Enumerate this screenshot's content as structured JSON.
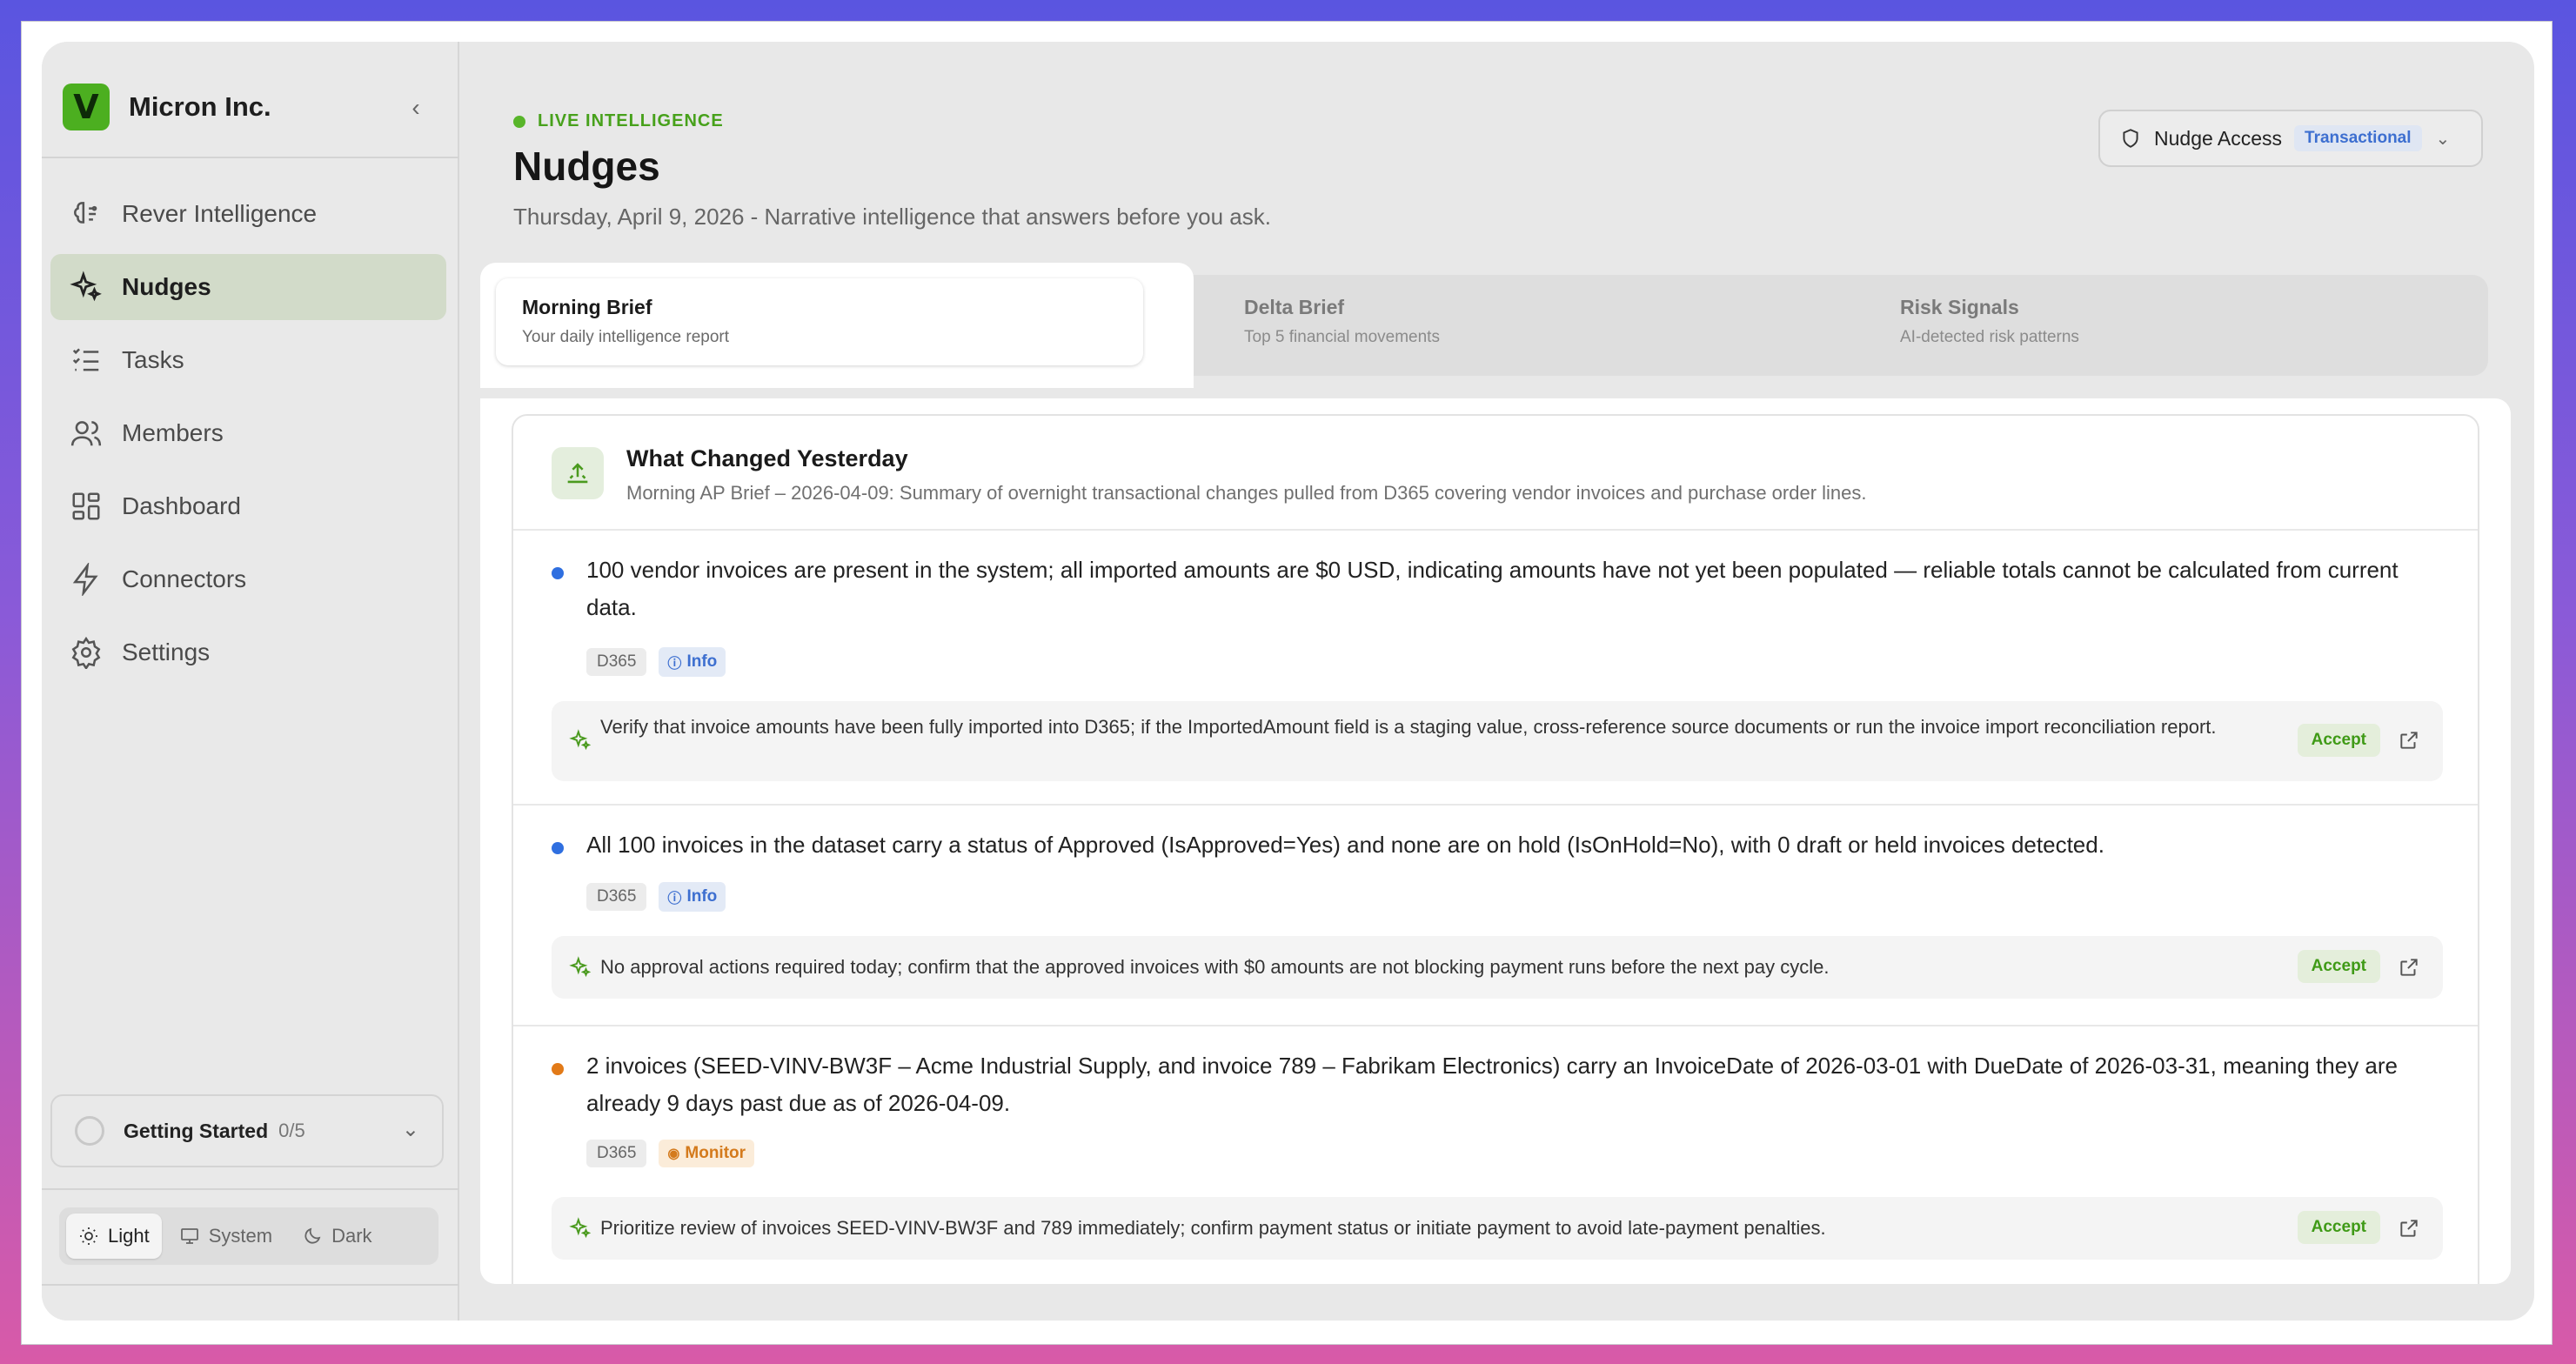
{
  "brand": {
    "name": "Micron Inc.",
    "logo_letter": "V"
  },
  "sidebar": {
    "items": [
      {
        "label": "Rever Intelligence",
        "icon": "brain-icon"
      },
      {
        "label": "Nudges",
        "icon": "sparkles-icon",
        "active": true
      },
      {
        "label": "Tasks",
        "icon": "checklist-icon"
      },
      {
        "label": "Members",
        "icon": "users-icon"
      },
      {
        "label": "Dashboard",
        "icon": "dashboard-icon"
      },
      {
        "label": "Connectors",
        "icon": "bolt-icon"
      },
      {
        "label": "Settings",
        "icon": "gear-icon"
      }
    ],
    "getting_started": {
      "label": "Getting Started",
      "count": "0/5"
    },
    "theme": {
      "light": "Light",
      "system": "System",
      "dark": "Dark",
      "selected": "Light"
    }
  },
  "header": {
    "live_label": "LIVE INTELLIGENCE",
    "title": "Nudges",
    "subtitle": "Thursday, April 9, 2026 - Narrative intelligence that answers before you ask.",
    "access": {
      "label": "Nudge Access",
      "badge": "Transactional"
    }
  },
  "tabs": [
    {
      "title": "Morning Brief",
      "subtitle": "Your daily intelligence report",
      "active": true
    },
    {
      "title": "Delta Brief",
      "subtitle": "Top 5 financial movements"
    },
    {
      "title": "Risk Signals",
      "subtitle": "AI-detected risk patterns"
    }
  ],
  "card": {
    "title": "What Changed Yesterday",
    "subtitle": "Morning AP Brief – 2026-04-09: Summary of overnight transactional changes pulled from D365 covering vendor invoices and purchase order lines.",
    "items": [
      {
        "text": "100 vendor invoices are present in the system; all imported amounts are $0 USD, indicating amounts have not yet been populated — reliable totals cannot be calculated from current data.",
        "source": "D365",
        "level": "Info",
        "recommendation": "Verify that invoice amounts have been fully imported into D365; if the ImportedAmount field is a staging value, cross-reference source documents or run the invoice import reconciliation report.",
        "accept": "Accept"
      },
      {
        "text": "All 100 invoices in the dataset carry a status of Approved (IsApproved=Yes) and none are on hold (IsOnHold=No), with 0 draft or held invoices detected.",
        "source": "D365",
        "level": "Info",
        "recommendation": "No approval actions required today; confirm that the approved invoices with $0 amounts are not blocking payment runs before the next pay cycle.",
        "accept": "Accept"
      },
      {
        "text": "2 invoices (SEED-VINV-BW3F – Acme Industrial Supply, and invoice 789 – Fabrikam Electronics) carry an InvoiceDate of 2026-03-01 with DueDate of 2026-03-31, meaning they are already 9 days past due as of 2026-04-09.",
        "source": "D365",
        "level": "Monitor",
        "recommendation": "Prioritize review of invoices SEED-VINV-BW3F and 789 immediately; confirm payment status or initiate payment to avoid late-payment penalties.",
        "accept": "Accept"
      }
    ]
  },
  "colors": {
    "accent": "#4caf20",
    "info": "#3d6fd0",
    "monitor": "#d47a1c",
    "bullet_info": "#2f6fe0",
    "bullet_monitor": "#e27a18"
  }
}
